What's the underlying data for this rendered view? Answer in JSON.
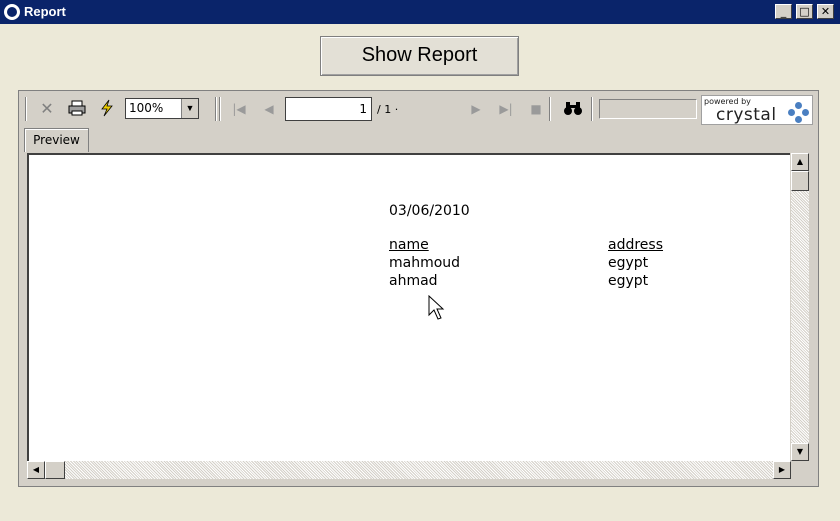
{
  "window": {
    "title": "Report",
    "controls": {
      "minimize": "_",
      "maximize": "□",
      "close": "✕"
    }
  },
  "show_report_button": {
    "label": "Show Report"
  },
  "toolbar": {
    "icons": [
      "close-icon",
      "print-icon",
      "refresh-lightning-icon",
      "first-page-icon",
      "prev-page-icon",
      "next-page-icon",
      "last-page-icon",
      "stop-icon",
      "binoculars-search-icon"
    ],
    "zoom_value": "100%",
    "current_page": "1",
    "total_pages": "/ 1 ·",
    "search_value": ""
  },
  "crystal_logo": {
    "powered_by": "powered by",
    "brand": "crystal",
    "color": "#4a7fc1"
  },
  "tabs": [
    {
      "label": "Preview"
    }
  ],
  "report": {
    "date": "03/06/2010",
    "columns": {
      "name": "name",
      "address": "address"
    },
    "rows": [
      {
        "name": "mahmoud",
        "address": "egypt"
      },
      {
        "name": "ahmad",
        "address": "egypt"
      }
    ]
  },
  "scrollbar": {
    "up": "▲",
    "down": "▼",
    "left": "◀",
    "right": "▶"
  }
}
